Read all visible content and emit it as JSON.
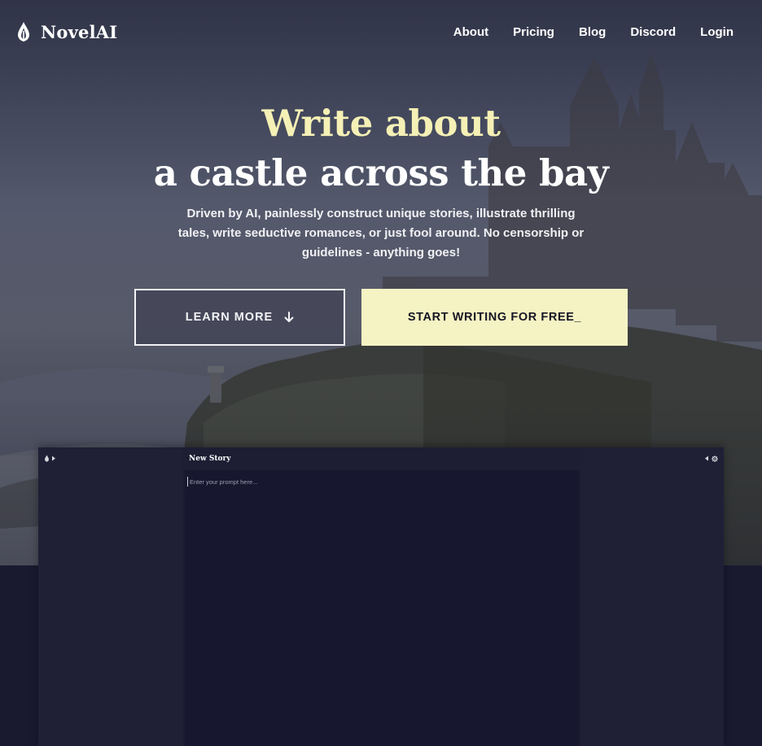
{
  "nav": {
    "brand": "NovelAI",
    "links": [
      "About",
      "Pricing",
      "Blog",
      "Discord",
      "Login"
    ]
  },
  "hero": {
    "line1": "Write about",
    "line2": "a castle across the bay",
    "subtitle": "Driven by AI, painlessly construct unique stories, illustrate thrilling tales, write seductive romances, or just fool around. No censorship or guidelines - anything goes!",
    "learn_more": "LEARN MORE",
    "start_writing": "START WRITING FOR FREE_"
  },
  "preview": {
    "story_title": "New Story",
    "prompt_placeholder": "Enter your prompt here..."
  },
  "icons": {
    "logo": "novelai-quill-logo-icon",
    "learn_more": "arrow-down-icon",
    "left_toggle": "chevron-right-icon",
    "right_toggle": "chevron-left-icon",
    "settings": "gear-icon"
  },
  "colors": {
    "accent_yellow": "#f5f2c4",
    "headline_yellow": "#f5f0b5",
    "dark_bg": "#191a30"
  }
}
